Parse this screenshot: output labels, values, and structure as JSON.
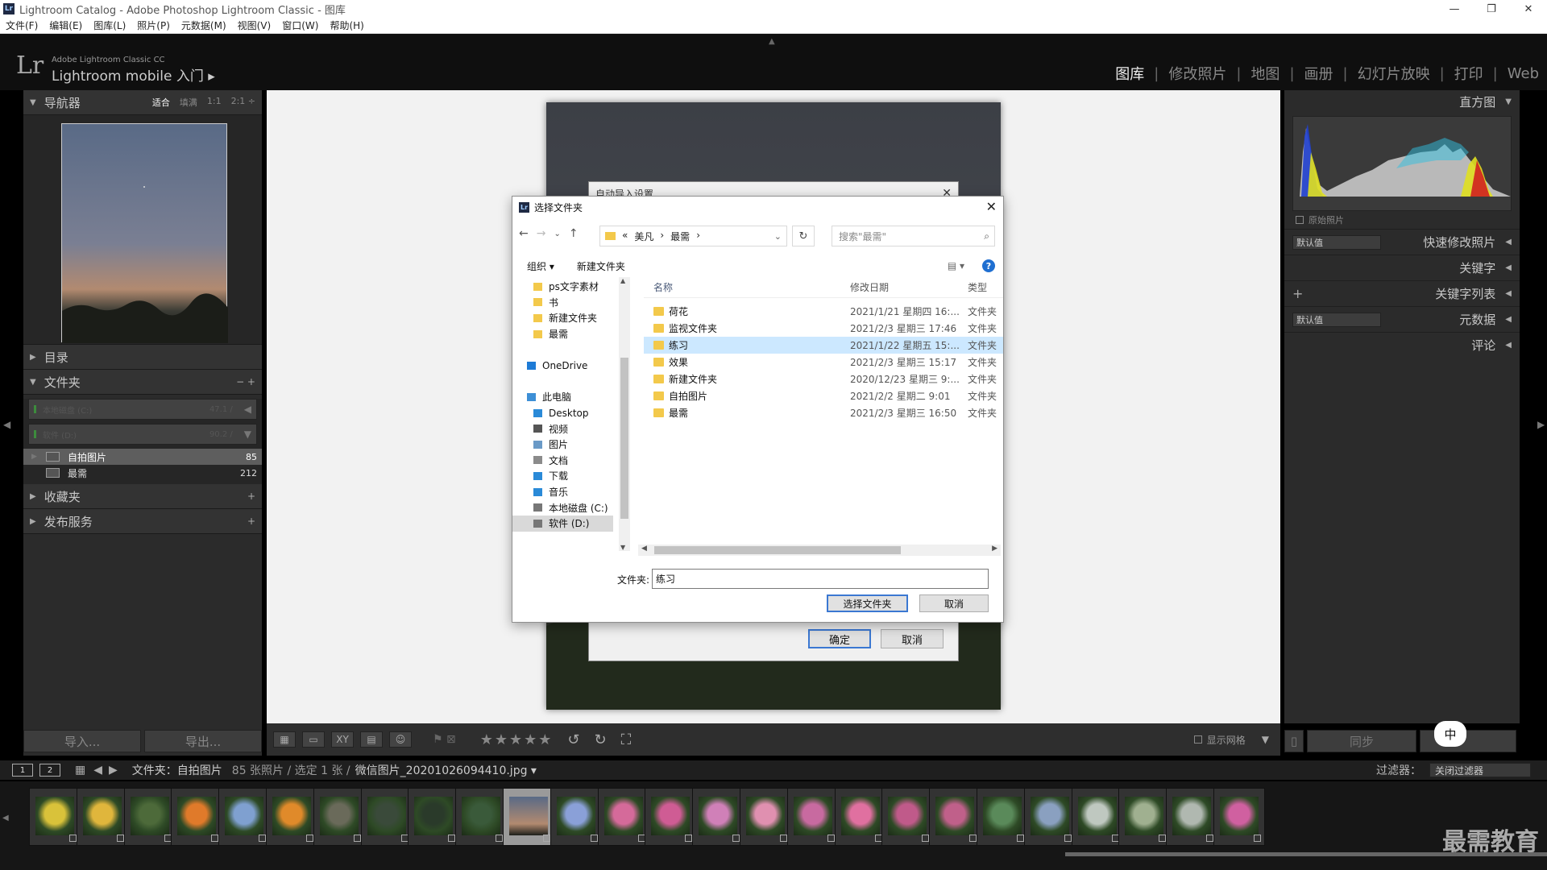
{
  "window": {
    "title": "Lightroom Catalog - Adobe Photoshop Lightroom Classic - 图库",
    "app_icon": "Lr",
    "controls": [
      "—",
      "❐",
      "✕"
    ]
  },
  "menu": [
    "文件(F)",
    "编辑(E)",
    "图库(L)",
    "照片(P)",
    "元数据(M)",
    "视图(V)",
    "窗口(W)",
    "帮助(H)"
  ],
  "identity": {
    "logo": "Lr",
    "product": "Adobe Lightroom Classic CC",
    "tagline": "Lightroom mobile 入门 ▸"
  },
  "modules": [
    "图库",
    "修改照片",
    "地图",
    "画册",
    "幻灯片放映",
    "打印",
    "Web"
  ],
  "active_module": "图库",
  "left_panel": {
    "navigator": {
      "title": "导航器",
      "zoom": [
        "适合",
        "填满",
        "1:1",
        "2:1 ÷"
      ]
    },
    "catalog": {
      "title": "目录"
    },
    "folders": {
      "title": "文件夹",
      "actions": "− +",
      "volumes": [
        {
          "name": "本地磁盘 (C:)",
          "size": "47.1 /"
        },
        {
          "name": "软件 (D:)",
          "size": "90.2 /"
        }
      ],
      "items": [
        {
          "name": "自拍图片",
          "count": "85",
          "selected": true
        },
        {
          "name": "最需",
          "count": "212",
          "selected": false
        }
      ]
    },
    "collections": {
      "title": "收藏夹",
      "action": "+"
    },
    "publish": {
      "title": "发布服务",
      "action": "+"
    },
    "import_button": "导入...",
    "export_button": "导出..."
  },
  "auto_import": {
    "title": "自动导入设置",
    "ok": "确定",
    "cancel": "取消"
  },
  "dialog": {
    "title": "选择文件夹",
    "breadcrumbs": [
      "«",
      "美凡",
      "›",
      "最需",
      "›"
    ],
    "search_placeholder": "搜索\"最需\"",
    "organize": "组织 ▾",
    "new_folder": "新建文件夹",
    "view_icon": "▤ ▾",
    "help": "?",
    "tree": [
      {
        "label": "ps文字素材",
        "icon": "folder-icon"
      },
      {
        "label": "书",
        "icon": "folder-icon"
      },
      {
        "label": "新建文件夹",
        "icon": "folder-icon"
      },
      {
        "label": "最需",
        "icon": "folder-icon"
      },
      {
        "label": "",
        "icon": ""
      },
      {
        "label": "OneDrive",
        "icon": "cloud-icon"
      },
      {
        "label": "",
        "icon": ""
      },
      {
        "label": "此电脑",
        "icon": "computer-icon"
      },
      {
        "label": "Desktop",
        "icon": "desktop-icon"
      },
      {
        "label": "视频",
        "icon": "video-icon"
      },
      {
        "label": "图片",
        "icon": "picture-icon"
      },
      {
        "label": "文档",
        "icon": "document-icon"
      },
      {
        "label": "下载",
        "icon": "download-icon"
      },
      {
        "label": "音乐",
        "icon": "music-icon"
      },
      {
        "label": "本地磁盘 (C:)",
        "icon": "drive-icon"
      },
      {
        "label": "软件 (D:)",
        "icon": "drive-icon"
      }
    ],
    "columns": [
      "名称",
      "修改日期",
      "类型"
    ],
    "files": [
      {
        "name": "荷花",
        "date": "2021/1/21 星期四 16:...",
        "type": "文件夹"
      },
      {
        "name": "监视文件夹",
        "date": "2021/2/3 星期三 17:46",
        "type": "文件夹"
      },
      {
        "name": "练习",
        "date": "2021/1/22 星期五 15:...",
        "type": "文件夹",
        "selected": true
      },
      {
        "name": "效果",
        "date": "2021/2/3 星期三 15:17",
        "type": "文件夹"
      },
      {
        "name": "新建文件夹",
        "date": "2020/12/23 星期三 9:...",
        "type": "文件夹"
      },
      {
        "name": "自拍图片",
        "date": "2021/2/2 星期二 9:01",
        "type": "文件夹"
      },
      {
        "name": "最需",
        "date": "2021/2/3 星期三 16:50",
        "type": "文件夹"
      }
    ],
    "folder_label": "文件夹:",
    "folder_value": "练习",
    "select_button": "选择文件夹",
    "cancel_button": "取消"
  },
  "right_panel": {
    "histogram": "直方图",
    "original_photo": "原始照片",
    "quick_develop": {
      "preset": "默认值",
      "label": "快速修改照片"
    },
    "keywords": "关键字",
    "keyword_list": {
      "action": "+",
      "label": "关键字列表"
    },
    "metadata": {
      "preset": "默认值",
      "label": "元数据"
    },
    "comments": "评论",
    "sync_button": "同步"
  },
  "toolbar": {
    "stars": "★★★★★",
    "show_grid": "显示网格"
  },
  "filmstrip_bar": {
    "monitor1": "1",
    "monitor2": "2",
    "source": "文件夹：自拍图片",
    "count": "85 张照片 / 选定 1 张 /",
    "filename": "微信图片_20201026094410.jpg ▾",
    "filter_label": "过滤器：",
    "filter_value": "关闭过滤器"
  },
  "filmstrip_count": 26,
  "selected_thumb_index": 10,
  "ime": "中",
  "watermark": "最需教育",
  "colors": {
    "dialog_selection": "#cce8ff",
    "folder": "#f3c94b",
    "accent_button": "#3b78d2"
  }
}
